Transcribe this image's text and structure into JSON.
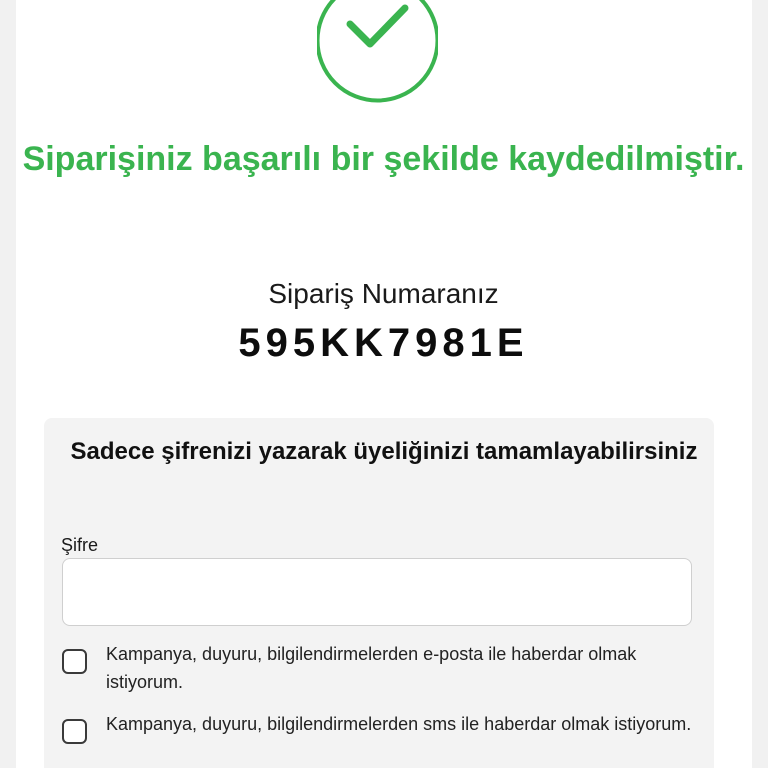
{
  "colors": {
    "success": "#3ab44f",
    "background": "#f1f1f1",
    "panel": "#f3f3f3"
  },
  "status": {
    "icon": "check-circle-icon",
    "title": "Siparişiniz başarılı bir şekilde kaydedilmiştir."
  },
  "order": {
    "label": "Sipariş Numaranız",
    "number": "595KK7981E"
  },
  "membership": {
    "heading": "Sadece şifrenizi yazarak üyeliğinizi tamamlayabilirsiniz",
    "password_label": "Şifre",
    "password_value": "",
    "consents": [
      {
        "label": "Kampanya, duyuru, bilgilendirmelerden e-posta ile haberdar olmak istiyorum.",
        "checked": false
      },
      {
        "label": "Kampanya, duyuru, bilgilendirmelerden sms ile haberdar olmak istiyorum.",
        "checked": false
      }
    ]
  }
}
